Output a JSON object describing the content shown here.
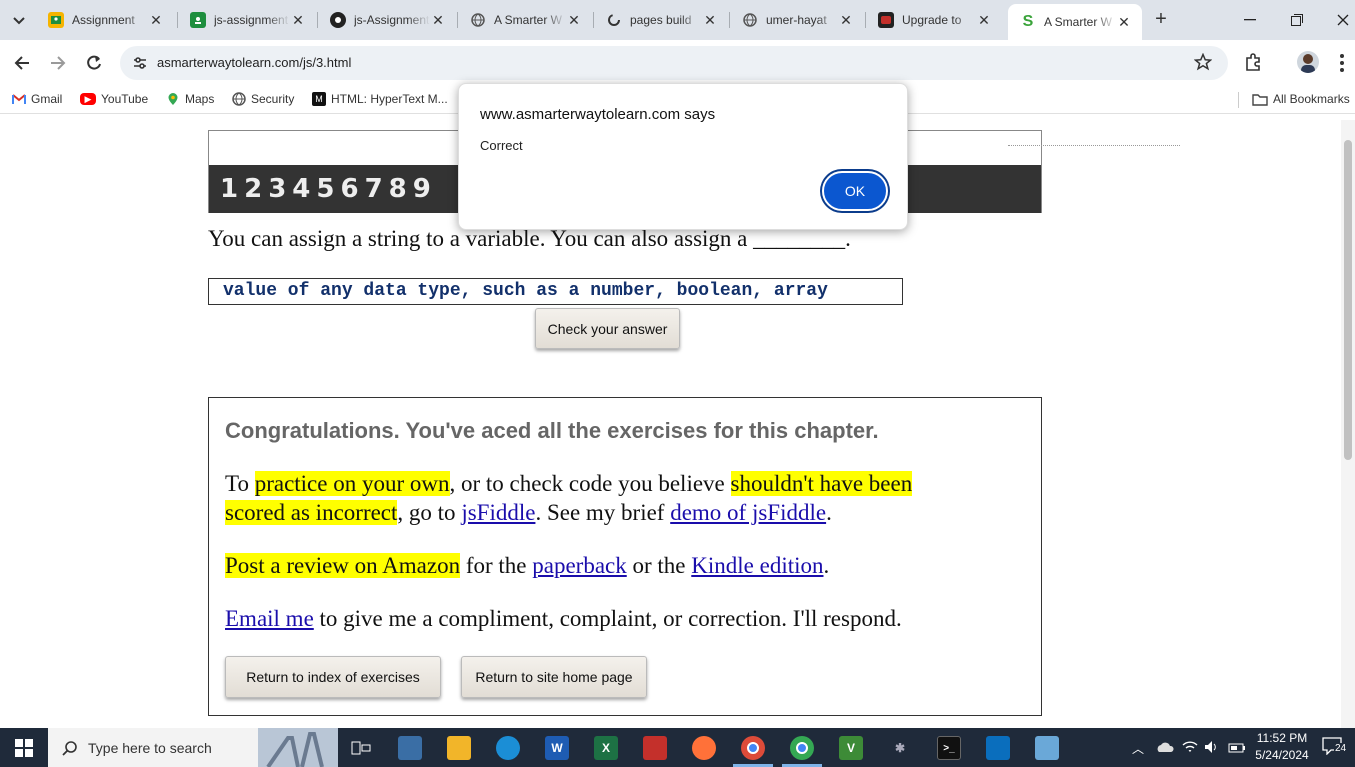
{
  "tabs": [
    {
      "label": "Assignment",
      "icon": "google-classroom-icon",
      "color": "#1e8e3e"
    },
    {
      "label": "js-assignment",
      "icon": "google-classroom-icon",
      "color": "#1e8e3e"
    },
    {
      "label": "js-Assignment",
      "icon": "github-icon",
      "color": "#222222"
    },
    {
      "label": "A Smarter W",
      "icon": "globe-icon",
      "color": "#555555"
    },
    {
      "label": "pages build",
      "icon": "github-actions-icon",
      "color": "#222222"
    },
    {
      "label": "umer-hayat",
      "icon": "globe-icon",
      "color": "#555555"
    },
    {
      "label": "Upgrade to",
      "icon": "app-icon",
      "color": "#c4302b"
    },
    {
      "label": "A Smarter W",
      "icon": "smarter-way-icon",
      "color": "#3aa33a"
    }
  ],
  "toolbar": {
    "url": "asmarterwaytolearn.com/js/3.html"
  },
  "bookmarks": {
    "items": [
      {
        "label": "Gmail",
        "icon": "gmail-icon"
      },
      {
        "label": "YouTube",
        "icon": "youtube-icon"
      },
      {
        "label": "Maps",
        "icon": "maps-icon"
      },
      {
        "label": "Security",
        "icon": "globe-icon"
      },
      {
        "label": "HTML: HyperText M...",
        "icon": "mdn-icon"
      }
    ],
    "all_label": "All Bookmarks"
  },
  "site": {
    "name": "A Smarter W",
    "numbers": [
      "1",
      "2",
      "3",
      "4",
      "5",
      "6",
      "7",
      "8",
      "9"
    ]
  },
  "exercise": {
    "question": "You can assign a string to a variable. You can also assign a ________.",
    "answer_value": "value of any data type, such as a number, boolean, array",
    "check_label": "Check your answer"
  },
  "congrats": {
    "title": "Congratulations. You've aced all the exercises for this chapter.",
    "p1": {
      "t1": "To ",
      "h1": "practice on your own",
      "t2": ", or to check code you believe ",
      "h2": "shouldn't have been",
      "h3": "scored as incorrect",
      "t3": ", go to ",
      "l1": "jsFiddle",
      "t4": ". See my brief ",
      "l2": "demo of jsFiddle",
      "t5": "."
    },
    "p2": {
      "h1": "Post a review on Amazon",
      "t1": " for the ",
      "l1": "paperback",
      "t2": " or the ",
      "l2": "Kindle edition",
      "t3": "."
    },
    "p3": {
      "l1": "Email me",
      "t1": " to give me a compliment, complaint, or correction. I'll respond."
    },
    "btn_index": "Return to index of exercises",
    "btn_home": "Return to site home page"
  },
  "alert": {
    "title": "www.asmarterwaytolearn.com says",
    "message": "Correct",
    "ok_label": "OK"
  },
  "taskbar": {
    "search_placeholder": "Type here to search",
    "time": "11:52 PM",
    "date": "5/24/2024",
    "notification_count": "24"
  }
}
